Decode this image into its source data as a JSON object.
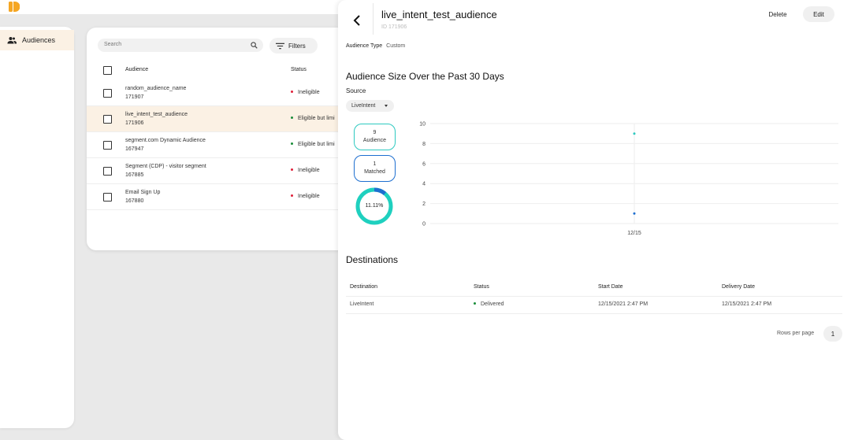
{
  "brand": {
    "accent": "#f5a623",
    "logo_icon": "brand-logo-icon"
  },
  "sidebar": {
    "items": [
      {
        "label": "Audiences",
        "icon": "people-icon",
        "active": true
      }
    ]
  },
  "list": {
    "search": {
      "placeholder": "Search"
    },
    "filters_label": "Filters",
    "columns": {
      "audience": "Audience",
      "status": "Status"
    },
    "rows": [
      {
        "name": "random_audience_name",
        "id": "171907",
        "status": "Ineligible",
        "status_color": "red"
      },
      {
        "name": "live_intent_test_audience",
        "id": "171906",
        "status": "Eligible but limi",
        "status_color": "green",
        "selected": true
      },
      {
        "name": "segment.com Dynamic Audience",
        "id": "167947",
        "status": "Eligible but limi",
        "status_color": "green"
      },
      {
        "name": "Segment (CDP) - visitor segment",
        "id": "167885",
        "status": "Ineligible",
        "status_color": "red"
      },
      {
        "name": "Email Sign Up",
        "id": "167880",
        "status": "Ineligible",
        "status_color": "red"
      }
    ]
  },
  "detail": {
    "title": "live_intent_test_audience",
    "id_text": "ID  171906",
    "delete_label": "Delete",
    "edit_label": "Edit",
    "audience_type_label": "Audience Type",
    "audience_type_value": "Custom",
    "size_heading": "Audience Size Over the Past 30 Days",
    "source_label": "Source",
    "source_value": "LiveIntent",
    "stats": {
      "audience_count": "9",
      "audience_label": "Audience",
      "matched_count": "1",
      "matched_label": "Matched",
      "match_rate": "11.11%",
      "match_rate_fraction": 0.1111,
      "audience_color": "#2dc9c0",
      "matched_color": "#1e6fd0"
    },
    "destinations_heading": "Destinations",
    "destinations_columns": {
      "destination": "Destination",
      "status": "Status",
      "start_date": "Start Date",
      "delivery_date": "Delivery Date"
    },
    "destinations_rows": [
      {
        "destination": "LiveIntent",
        "status": "Delivered",
        "start_date": "12/15/2021 2:47 PM",
        "delivery_date": "12/15/2021 2:47 PM"
      }
    ],
    "rows_per_page_label": "Rows per page",
    "rows_per_page_value": "1"
  },
  "chart_data": {
    "type": "scatter",
    "x": [
      "12/15"
    ],
    "series": [
      {
        "values": [
          9
        ],
        "color": "#2dc9c0"
      },
      {
        "values": [
          1
        ],
        "color": "#1e6fd0"
      }
    ],
    "yticks": [
      0,
      2,
      4,
      6,
      8,
      10
    ],
    "ylim": [
      0,
      10
    ],
    "grid": true,
    "title": "",
    "xlabel": "",
    "ylabel": ""
  }
}
